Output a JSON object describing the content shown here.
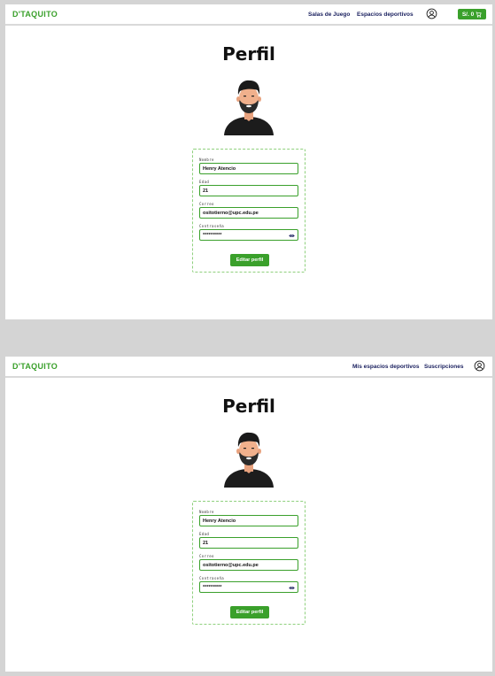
{
  "screens": [
    {
      "logo": "D'TAQUITO",
      "nav_links": [
        "Salas de Juego",
        "Espacios deportivos"
      ],
      "user_icon": "user-circle-icon",
      "cart": {
        "label": "S/. 0",
        "icon": "cart-icon"
      },
      "title": "Perfil",
      "avatar": "bearded-man-avatar",
      "fields": [
        {
          "label": "Nombre",
          "value": "Henry Atencio"
        },
        {
          "label": "Edad",
          "value": "21"
        },
        {
          "label": "Correo",
          "value": "ositotierno@upc.edu.pe"
        },
        {
          "label": "Contraseña",
          "value": "**********",
          "icon": "eye-icon"
        }
      ],
      "button": "Editar perfil"
    },
    {
      "logo": "D'TAQUITO",
      "nav_links": [
        "Mis espacios deportivos",
        "Suscripciones"
      ],
      "user_icon": "user-circle-icon",
      "title": "Perfil",
      "avatar": "bearded-man-avatar",
      "fields": [
        {
          "label": "Nombre",
          "value": "Henry Atencio"
        },
        {
          "label": "Edad",
          "value": "21"
        },
        {
          "label": "Correo",
          "value": "ositotierno@upc.edu.pe"
        },
        {
          "label": "Contraseña",
          "value": "**********",
          "icon": "eye-icon"
        }
      ],
      "button": "Editar perfil"
    }
  ],
  "colors": {
    "brand": "#3aa02b",
    "nav_text": "#1c2260",
    "divider": "#d9d9d9",
    "outer_bg": "#d4d4d4"
  }
}
